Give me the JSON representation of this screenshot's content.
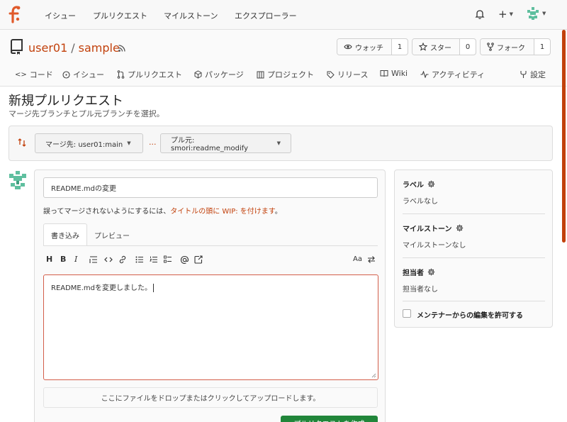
{
  "topnav": {
    "links": [
      "イシュー",
      "プルリクエスト",
      "マイルストーン",
      "エクスプローラー"
    ],
    "plus_label": "+"
  },
  "repo": {
    "owner": "user01",
    "separator": "/",
    "name": "sample",
    "watch_label": "ウォッチ",
    "watch_count": "1",
    "star_label": "スター",
    "star_count": "0",
    "fork_label": "フォーク",
    "fork_count": "1"
  },
  "tabs": {
    "code": "コード",
    "issues": "イシュー",
    "pulls": "プルリクエスト",
    "packages": "パッケージ",
    "projects": "プロジェクト",
    "releases": "リリース",
    "wiki": "Wiki",
    "activity": "アクティビティ",
    "settings": "設定"
  },
  "page": {
    "title": "新規プルリクエスト",
    "subtitle": "マージ先ブランチとプル元ブランチを選択。"
  },
  "branches": {
    "base": "マージ先: user01:main",
    "dots": "...",
    "head": "プル元: smori:readme_modify"
  },
  "form": {
    "title_value": "README.mdの変更",
    "wip_prefix": "誤ってマージされないようにするには、",
    "wip_link": "タイトルの頭に WIP: を付けます",
    "wip_suffix": "。",
    "write_tab": "書き込み",
    "preview_tab": "プレビュー",
    "toolbar_aa": "Aa",
    "body_value": "README.mdを変更しました。",
    "dropzone": "ここにファイルをドロップまたはクリックしてアップロードします。",
    "submit": "プルリクエストを作成"
  },
  "sidebar": {
    "labels_head": "ラベル",
    "labels_value": "ラベルなし",
    "milestone_head": "マイルストーン",
    "milestone_value": "マイルストーンなし",
    "assignee_head": "担当者",
    "assignee_value": "担当者なし",
    "allow_edits": "メンテナーからの編集を許可する"
  },
  "colors": {
    "accent": "#c2410c",
    "submit": "#21863a",
    "textarea_border": "#d35e4a"
  },
  "icons": {
    "logo": "gitea-logo",
    "bell": "bell-icon",
    "plus": "plus-icon",
    "avatar": "avatar-icon",
    "repo": "repo-icon",
    "rss": "rss-icon",
    "eye": "eye-icon",
    "star": "star-icon",
    "fork": "fork-icon",
    "gear": "gear-icon"
  }
}
